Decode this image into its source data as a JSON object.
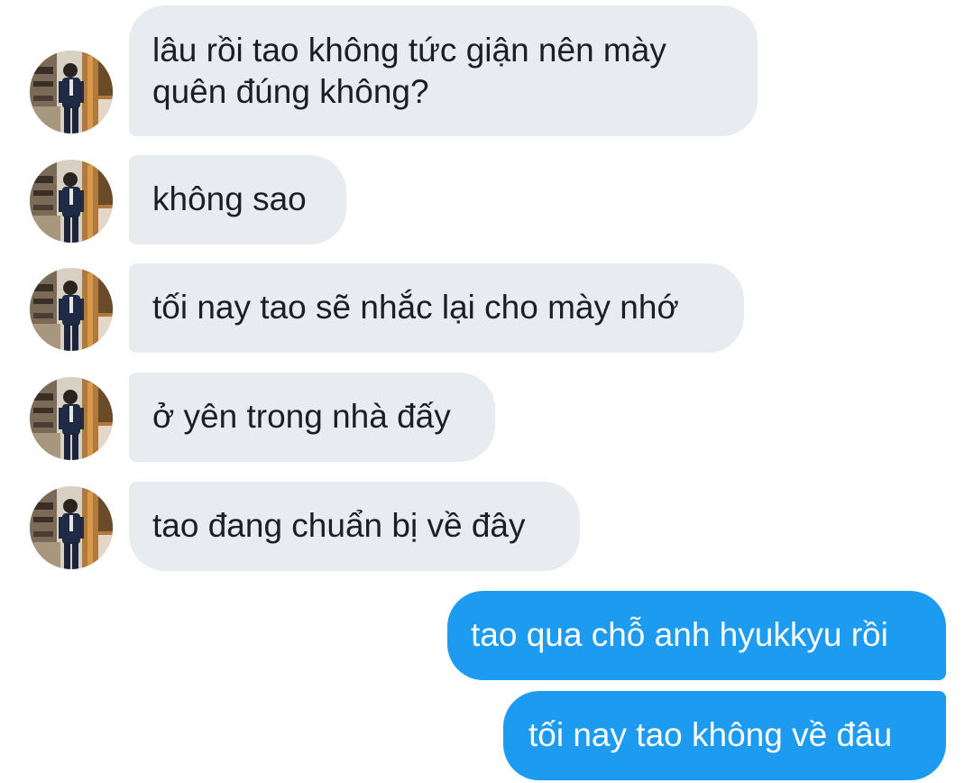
{
  "conversation": {
    "messages": [
      {
        "sender": "other",
        "text": "lâu rồi tao không tức giận nên mày quên đúng không?"
      },
      {
        "sender": "other",
        "text": "không sao"
      },
      {
        "sender": "other",
        "text": "tối nay tao sẽ nhắc lại cho mày nhớ"
      },
      {
        "sender": "other",
        "text": "ở yên trong nhà đấy"
      },
      {
        "sender": "other",
        "text": "tao đang chuẩn bị về đây"
      },
      {
        "sender": "me",
        "text": "tao qua chỗ anh hyukkyu rồi"
      },
      {
        "sender": "me",
        "text": "tối nay tao không về đâu"
      }
    ]
  },
  "colors": {
    "incoming_bubble": "#e8ebef",
    "incoming_text": "#1c1e21",
    "outgoing_bubble": "#1d9bf0",
    "outgoing_text": "#ffffff",
    "background": "#ffffff"
  },
  "icons": {
    "avatar": "avatar-photo-man-in-suit"
  }
}
